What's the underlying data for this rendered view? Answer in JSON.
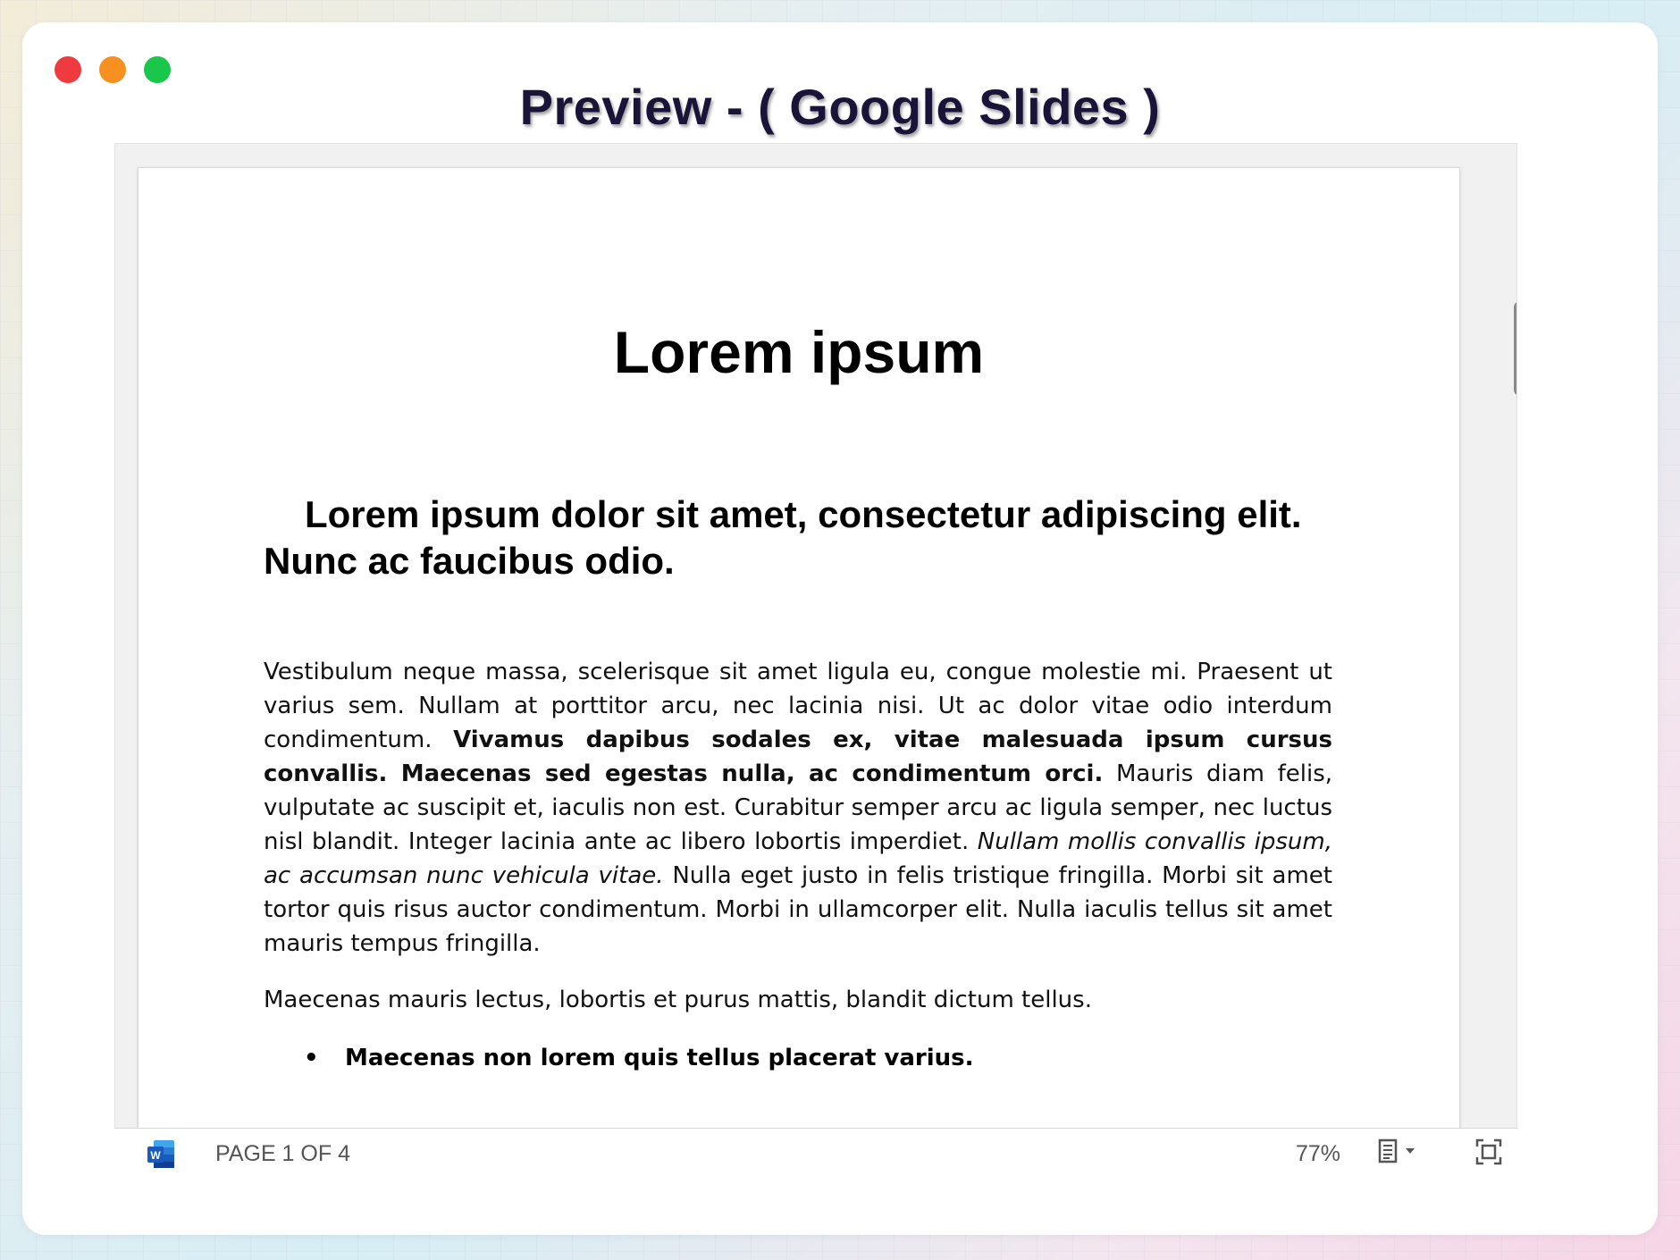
{
  "window": {
    "title": "Preview - ( Google Slides )",
    "controls": [
      "close",
      "minimize",
      "maximize"
    ]
  },
  "document": {
    "title": "Lorem ipsum",
    "subtitle": "Lorem ipsum dolor sit amet, consectetur adipiscing elit. Nunc ac faucibus odio.",
    "paragraph1": {
      "run1": "Vestibulum neque massa, scelerisque sit amet ligula eu, congue molestie mi. Praesent ut varius sem. Nullam at porttitor arcu, nec lacinia nisi. Ut ac dolor vitae odio interdum condimentum. ",
      "bold": "Vivamus dapibus sodales ex, vitae malesuada ipsum cursus convallis. Maecenas sed egestas nulla, ac condimentum orci.",
      "run2": " Mauris diam felis, vulputate ac suscipit et, iaculis non est. Curabitur semper arcu ac ligula semper, nec luctus nisl blandit. Integer lacinia ante ac libero lobortis imperdiet. ",
      "italic": "Nullam mollis convallis ipsum, ac accumsan nunc vehicula vitae.",
      "run3": " Nulla eget justo in felis tristique fringilla. Morbi sit amet tortor quis risus auctor condimentum. Morbi in ullamcorper elit. Nulla iaculis tellus sit amet mauris tempus fringilla."
    },
    "paragraph2": "Maecenas mauris lectus, lobortis et purus mattis, blandit dictum tellus.",
    "bullets": [
      {
        "marker": "•",
        "text": "Maecenas non lorem quis tellus placerat varius."
      }
    ]
  },
  "statusbar": {
    "file_icon": "word-icon",
    "page_indicator": "PAGE 1 OF 4",
    "zoom": "77%",
    "view_icon": "page-view-icon",
    "fullscreen_icon": "fullscreen-icon"
  },
  "colors": {
    "close": "#ef3b3f",
    "minimize": "#f7901e",
    "maximize": "#19c74a",
    "title_text": "#1a1538",
    "word_blue": "#185abd"
  }
}
